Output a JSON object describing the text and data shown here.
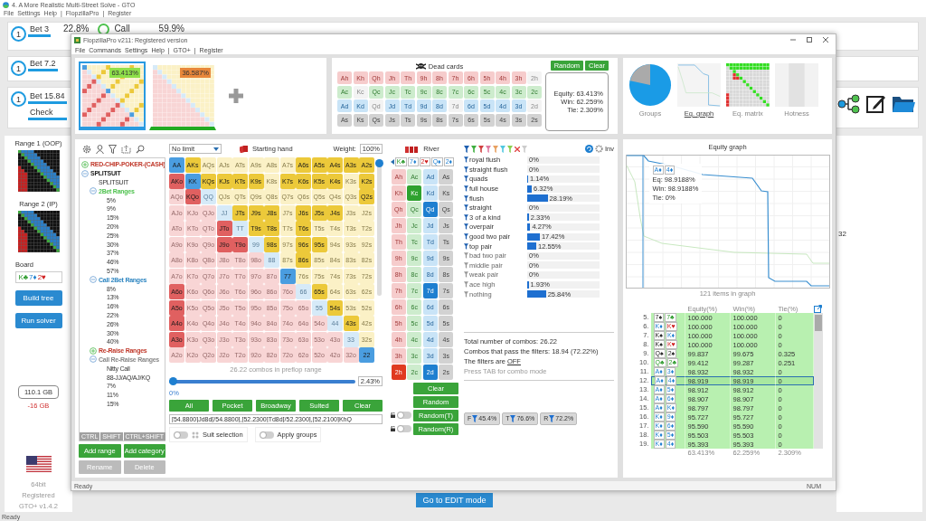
{
  "app": {
    "title": "4. A More Realistic Multi-Street Solve - GTO",
    "menu": [
      "File",
      "Settings",
      "Help",
      "|",
      "FlopzillaPro",
      "|",
      "Register"
    ]
  },
  "nodes": [
    {
      "player": "1",
      "actions": [
        "Bet 3"
      ],
      "freq": "22.8%",
      "next_action": "Call",
      "next_freq": "59.9%"
    },
    {
      "player": "1",
      "actions": [
        "Bet 7.2"
      ]
    },
    {
      "player": "1",
      "actions": [
        "Bet 15.84",
        "Check"
      ]
    }
  ],
  "sidebar": {
    "range1_label": "Range 1 (OOP)",
    "range2_label": "Range 2 (IP)",
    "board_label": "Board",
    "board": [
      {
        "text": "K♣",
        "kind": "clubs"
      },
      {
        "text": "7♦",
        "kind": "diamonds"
      },
      {
        "text": "2♥",
        "kind": "hearts"
      }
    ],
    "buttons": [
      "Build tree",
      "Run solver"
    ],
    "memory": "110.1 GB",
    "memory_delta": "-16 GB",
    "bits": "64bit",
    "registration": "Registered",
    "version": "GTO+ v1.4.2"
  },
  "edit_button": "Go to EDIT mode",
  "right_text": "32",
  "status": "Ready",
  "flopzilla": {
    "title": "FlopzillaPro v211: Registered version",
    "menu": [
      "File",
      "Commands",
      "Settings",
      "Help",
      "|",
      "GTO+",
      "|",
      "Register"
    ],
    "status": "Ready",
    "status_right": "NUM"
  },
  "range_slots": [
    {
      "equity": "63.413%",
      "selected": true,
      "color": "#8fe04a"
    },
    {
      "equity": "36.587%",
      "selected": false,
      "color": "#e8873a"
    }
  ],
  "dead_cards": {
    "title": "Dead cards",
    "buttons": [
      "Random",
      "Clear"
    ],
    "rows": [
      {
        "kind": "hearts",
        "cards": [
          "Ah",
          "Kh",
          "Qh",
          "Jh",
          "Th",
          "9h",
          "8h",
          "7h",
          "6h",
          "5h",
          "4h",
          "3h",
          "2h"
        ],
        "dead": [
          false,
          false,
          false,
          false,
          false,
          false,
          false,
          false,
          false,
          false,
          false,
          false,
          true
        ]
      },
      {
        "kind": "clubs",
        "cards": [
          "Ac",
          "Kc",
          "Qc",
          "Jc",
          "Tc",
          "9c",
          "8c",
          "7c",
          "6c",
          "5c",
          "4c",
          "3c",
          "2c"
        ],
        "dead": [
          false,
          true,
          false,
          false,
          false,
          false,
          false,
          false,
          false,
          false,
          false,
          false,
          false
        ]
      },
      {
        "kind": "diamonds",
        "cards": [
          "Ad",
          "Kd",
          "Qd",
          "Jd",
          "Td",
          "9d",
          "8d",
          "7d",
          "6d",
          "5d",
          "4d",
          "3d",
          "2d"
        ],
        "dead": [
          false,
          false,
          true,
          false,
          false,
          false,
          false,
          true,
          false,
          false,
          false,
          false,
          true
        ]
      },
      {
        "kind": "spades",
        "cards": [
          "As",
          "Ks",
          "Qs",
          "Js",
          "Ts",
          "9s",
          "8s",
          "7s",
          "6s",
          "5s",
          "4s",
          "3s",
          "2s"
        ],
        "dead": [
          false,
          false,
          false,
          false,
          false,
          false,
          false,
          false,
          false,
          false,
          false,
          false,
          false
        ]
      }
    ],
    "equity": "Equity: 63.413%",
    "win": "Win: 62.259%",
    "tie": "Tie: 2.309%"
  },
  "views": [
    {
      "label": "Groups",
      "selected": false,
      "kind": "pie"
    },
    {
      "label": "Eq. graph",
      "selected": true,
      "kind": "graph"
    },
    {
      "label": "Eq. matrix",
      "selected": false,
      "kind": "matrix"
    },
    {
      "label": "Hotness",
      "selected": false,
      "kind": "hotness"
    }
  ],
  "tree": [
    {
      "label": "RED-CHIP-POKER-(CASH)",
      "color": "#c0392b",
      "expanded": false
    },
    {
      "label": "SPLITSUIT",
      "color": "#222222",
      "expanded": true,
      "children": [
        {
          "label": "SPLITSUIT"
        },
        {
          "label": "2Bet Ranges",
          "color": "#4fc24f",
          "expanded": true,
          "children": [
            {
              "label": "5%"
            },
            {
              "label": "9%"
            },
            {
              "label": "15%"
            },
            {
              "label": "20%"
            },
            {
              "label": "25%"
            },
            {
              "label": "30%"
            },
            {
              "label": "37%"
            },
            {
              "label": "46%"
            },
            {
              "label": "57%"
            }
          ]
        },
        {
          "label": "Call 2Bet Ranges",
          "color": "#2e86c1",
          "expanded": true,
          "children": [
            {
              "label": "8%"
            },
            {
              "label": "13%"
            },
            {
              "label": "16%"
            },
            {
              "label": "22%"
            },
            {
              "label": "26%"
            },
            {
              "label": "30%"
            },
            {
              "label": "40%"
            }
          ]
        },
        {
          "label": "Re-Raise Ranges",
          "color": "#c0392b",
          "expanded": false
        },
        {
          "label": "Call Re-Raise Ranges",
          "color": "#888888",
          "expanded": true,
          "children": [
            {
              "label": "Nitty Call"
            },
            {
              "label": "88-JJ/AQ/AJ/KQ"
            },
            {
              "label": "7%"
            },
            {
              "label": "11%"
            },
            {
              "label": "15%"
            }
          ]
        }
      ]
    }
  ],
  "modifiers": [
    "CTRL",
    "SHIFT",
    "CTRL+SHIFT"
  ],
  "tree_buttons": [
    {
      "label": "Add range",
      "disabled": false
    },
    {
      "label": "Add category",
      "disabled": false
    },
    {
      "label": "Rename",
      "disabled": true
    },
    {
      "label": "Delete",
      "disabled": true
    }
  ],
  "hand_matrix": {
    "game": "No limit",
    "title": "Starting hand",
    "weight_label": "Weight:",
    "weight": "100%",
    "weight_slider": {
      "level": 1
    },
    "rows": [
      {
        "hands": [
          "AA",
          "AKs",
          "AQs",
          "AJs",
          "ATs",
          "A9s",
          "A8s",
          "A7s",
          "A6s",
          "A5s",
          "A4s",
          "A3s",
          "A2s"
        ],
        "in_range": [
          true,
          true,
          false,
          false,
          false,
          false,
          false,
          false,
          true,
          true,
          true,
          true,
          true
        ]
      },
      {
        "hands": [
          "AKo",
          "KK",
          "KQs",
          "KJs",
          "KTs",
          "K9s",
          "K8s",
          "K7s",
          "K6s",
          "K5s",
          "K4s",
          "K3s",
          "K2s"
        ],
        "in_range": [
          true,
          true,
          true,
          true,
          true,
          true,
          false,
          true,
          true,
          true,
          true,
          false,
          true
        ]
      },
      {
        "hands": [
          "AQo",
          "KQo",
          "QQ",
          "QJs",
          "QTs",
          "Q9s",
          "Q8s",
          "Q7s",
          "Q6s",
          "Q5s",
          "Q4s",
          "Q3s",
          "Q2s"
        ],
        "in_range": [
          false,
          true,
          false,
          false,
          false,
          false,
          false,
          false,
          false,
          false,
          false,
          false,
          true
        ]
      },
      {
        "hands": [
          "AJo",
          "KJo",
          "QJo",
          "JJ",
          "JTs",
          "J9s",
          "J8s",
          "J7s",
          "J6s",
          "J5s",
          "J4s",
          "J3s",
          "J2s"
        ],
        "in_range": [
          false,
          false,
          false,
          false,
          true,
          true,
          true,
          false,
          true,
          true,
          true,
          false,
          false
        ]
      },
      {
        "hands": [
          "ATo",
          "KTo",
          "QTo",
          "JTo",
          "TT",
          "T9s",
          "T8s",
          "T7s",
          "T6s",
          "T5s",
          "T4s",
          "T3s",
          "T2s"
        ],
        "in_range": [
          false,
          false,
          false,
          true,
          false,
          true,
          true,
          false,
          true,
          false,
          false,
          false,
          false
        ]
      },
      {
        "hands": [
          "A9o",
          "K9o",
          "Q9o",
          "J9o",
          "T9o",
          "99",
          "98s",
          "97s",
          "96s",
          "95s",
          "94s",
          "93s",
          "92s"
        ],
        "in_range": [
          false,
          false,
          false,
          true,
          true,
          false,
          true,
          false,
          true,
          true,
          false,
          false,
          false
        ]
      },
      {
        "hands": [
          "A8o",
          "K8o",
          "Q8o",
          "J8o",
          "T8o",
          "98o",
          "88",
          "87s",
          "86s",
          "85s",
          "84s",
          "83s",
          "82s"
        ],
        "in_range": [
          false,
          false,
          false,
          false,
          false,
          false,
          false,
          false,
          true,
          false,
          false,
          false,
          false
        ]
      },
      {
        "hands": [
          "A7o",
          "K7o",
          "Q7o",
          "J7o",
          "T7o",
          "97o",
          "87o",
          "77",
          "76s",
          "75s",
          "74s",
          "73s",
          "72s"
        ],
        "in_range": [
          false,
          false,
          false,
          false,
          false,
          false,
          false,
          true,
          false,
          false,
          false,
          false,
          false
        ]
      },
      {
        "hands": [
          "A6o",
          "K6o",
          "Q6o",
          "J6o",
          "T6o",
          "96o",
          "86o",
          "76o",
          "66",
          "65s",
          "64s",
          "63s",
          "62s"
        ],
        "in_range": [
          true,
          false,
          false,
          false,
          false,
          false,
          false,
          false,
          false,
          true,
          false,
          false,
          false
        ]
      },
      {
        "hands": [
          "A5o",
          "K5o",
          "Q5o",
          "J5o",
          "T5o",
          "95o",
          "85o",
          "75o",
          "65o",
          "55",
          "54s",
          "53s",
          "52s"
        ],
        "in_range": [
          true,
          false,
          false,
          false,
          false,
          false,
          false,
          false,
          false,
          false,
          true,
          false,
          false
        ]
      },
      {
        "hands": [
          "A4o",
          "K4o",
          "Q4o",
          "J4o",
          "T4o",
          "94o",
          "84o",
          "74o",
          "64o",
          "54o",
          "44",
          "43s",
          "42s"
        ],
        "in_range": [
          true,
          false,
          false,
          false,
          false,
          false,
          false,
          false,
          false,
          false,
          false,
          true,
          false
        ]
      },
      {
        "hands": [
          "A3o",
          "K3o",
          "Q3o",
          "J3o",
          "T3o",
          "93o",
          "83o",
          "73o",
          "63o",
          "53o",
          "43o",
          "33",
          "32s"
        ],
        "in_range": [
          true,
          false,
          false,
          false,
          false,
          false,
          false,
          false,
          false,
          false,
          false,
          false,
          false
        ]
      },
      {
        "hands": [
          "A2o",
          "K2o",
          "Q2o",
          "J2o",
          "T2o",
          "92o",
          "82o",
          "72o",
          "62o",
          "52o",
          "42o",
          "32o",
          "22"
        ],
        "in_range": [
          false,
          false,
          false,
          false,
          false,
          false,
          false,
          false,
          false,
          false,
          false,
          false,
          true
        ]
      }
    ],
    "combos": "26.22 combos in preflop range",
    "range_slider": {
      "level": 0
    },
    "slider_min": "0%",
    "slider_max": "2.43%",
    "presets": [
      "All",
      "Pocket",
      "Broadway",
      "Suited",
      "Clear"
    ],
    "range_text": "[54.8800]Jd8d[/54.8800],[52.2300]Td8d[/52.2300],[52.2100]KhQ",
    "toggles": [
      {
        "label": "Suit selection",
        "on": false
      },
      {
        "label": "Apply groups",
        "on": false
      }
    ]
  },
  "river": {
    "title": "River",
    "board": [
      {
        "text": "K♣",
        "kind": "clubs"
      },
      {
        "text": "7♦",
        "kind": "diamonds"
      },
      {
        "text": "2♥",
        "kind": "hearts"
      },
      {
        "text": "Q♦",
        "kind": "diamonds"
      },
      {
        "text": "2♦",
        "kind": "diamonds"
      }
    ],
    "columns": [
      {
        "kind": "hearts",
        "cards": [
          "Ah",
          "Kh",
          "Qh",
          "Jh",
          "Th",
          "9h",
          "8h",
          "7h",
          "6h",
          "5h",
          "4h",
          "3h",
          "2h"
        ],
        "selected": [
          false,
          false,
          false,
          false,
          false,
          false,
          false,
          false,
          false,
          false,
          false,
          false,
          true
        ]
      },
      {
        "kind": "clubs",
        "cards": [
          "Ac",
          "Kc",
          "Qc",
          "Jc",
          "Tc",
          "9c",
          "8c",
          "7c",
          "6c",
          "5c",
          "4c",
          "3c",
          "2c"
        ],
        "selected": [
          false,
          true,
          false,
          false,
          false,
          false,
          false,
          false,
          false,
          false,
          false,
          false,
          false
        ]
      },
      {
        "kind": "diamonds",
        "cards": [
          "Ad",
          "Kd",
          "Qd",
          "Jd",
          "Td",
          "9d",
          "8d",
          "7d",
          "6d",
          "5d",
          "4d",
          "3d",
          "2d"
        ],
        "selected": [
          false,
          false,
          true,
          false,
          false,
          false,
          false,
          true,
          false,
          false,
          false,
          false,
          true
        ]
      },
      {
        "kind": "spades",
        "cards": [
          "As",
          "Ks",
          "Qs",
          "Js",
          "Ts",
          "9s",
          "8s",
          "7s",
          "6s",
          "5s",
          "4s",
          "3s",
          "2s"
        ],
        "selected": [
          false,
          false,
          false,
          false,
          false,
          false,
          false,
          false,
          false,
          false,
          false,
          false,
          false
        ]
      }
    ],
    "buttons": [
      {
        "label": "Clear"
      },
      {
        "label": "Random"
      },
      {
        "label": "Random(T)",
        "locked": false
      },
      {
        "label": "Random(R)",
        "locked": false
      }
    ]
  },
  "filters": {
    "inv": "Inv",
    "items": [
      {
        "label": "royal flush",
        "value": "0%",
        "level": 0,
        "active": true
      },
      {
        "label": "straight flush",
        "value": "0%",
        "level": 0,
        "active": true
      },
      {
        "label": "quads",
        "value": "1.14%",
        "level": 0.0114,
        "active": true
      },
      {
        "label": "full house",
        "value": "6.32%",
        "level": 0.0632,
        "active": true
      },
      {
        "label": "flush",
        "value": "28.19%",
        "level": 0.2819,
        "active": true
      },
      {
        "label": "straight",
        "value": "0%",
        "level": 0,
        "active": true
      },
      {
        "label": "3 of a kind",
        "value": "2.33%",
        "level": 0.0233,
        "active": true
      },
      {
        "label": "overpair",
        "value": "4.27%",
        "level": 0.0427,
        "active": true
      },
      {
        "label": "good two pair",
        "value": "17.42%",
        "level": 0.1742,
        "active": true
      },
      {
        "label": "top pair",
        "value": "12.55%",
        "level": 0.1255,
        "active": true
      },
      {
        "label": "bad two pair",
        "value": "0%",
        "level": 0,
        "active": false
      },
      {
        "label": "middle pair",
        "value": "0%",
        "level": 0,
        "active": false
      },
      {
        "label": "weak pair",
        "value": "0%",
        "level": 0,
        "active": false
      },
      {
        "label": "ace high",
        "value": "1.93%",
        "level": 0.0193,
        "active": false
      },
      {
        "label": "nothing",
        "value": "25.84%",
        "level": 0.2584,
        "active": false
      }
    ],
    "total": "Total number of combos: 26.22",
    "passing": "Combos that pass the filters: 18.94 (72.22%)",
    "state_prefix": "The filters are",
    "state": "OFF",
    "hint": "Press TAB for combo mode",
    "badges": [
      {
        "letter": "F",
        "value": "45.4%"
      },
      {
        "letter": "T",
        "value": "76.6%"
      },
      {
        "letter": "R",
        "value": "72.2%"
      }
    ]
  },
  "equity_graph": {
    "title": "Equity graph",
    "tooltip": {
      "cards": [
        {
          "text": "A♦",
          "kind": "diamonds"
        },
        {
          "text": "4♦",
          "kind": "diamonds"
        }
      ],
      "lines": [
        "Eq: 98.9188%",
        "Win: 98.9188%",
        "Tie: 0%"
      ]
    },
    "caption": "121 items in graph"
  },
  "table": {
    "columns": [
      "Equity(%)",
      "Win(%)",
      "Tie(%)"
    ],
    "rows": [
      {
        "index": "5.",
        "cards": [
          {
            "text": "7♠",
            "kind": "spades"
          },
          {
            "text": "7♣",
            "kind": "clubs"
          }
        ],
        "equity": "100.000",
        "win": "100.000",
        "tie": "0",
        "selected": false
      },
      {
        "index": "6.",
        "cards": [
          {
            "text": "K♦",
            "kind": "diamonds"
          },
          {
            "text": "K♥",
            "kind": "hearts"
          }
        ],
        "equity": "100.000",
        "win": "100.000",
        "tie": "0",
        "selected": false
      },
      {
        "index": "7.",
        "cards": [
          {
            "text": "K♠",
            "kind": "spades"
          },
          {
            "text": "K♦",
            "kind": "diamonds"
          }
        ],
        "equity": "100.000",
        "win": "100.000",
        "tie": "0",
        "selected": false
      },
      {
        "index": "8.",
        "cards": [
          {
            "text": "K♠",
            "kind": "spades"
          },
          {
            "text": "K♥",
            "kind": "hearts"
          }
        ],
        "equity": "100.000",
        "win": "100.000",
        "tie": "0",
        "selected": false
      },
      {
        "index": "9.",
        "cards": [
          {
            "text": "Q♠",
            "kind": "spades"
          },
          {
            "text": "2♠",
            "kind": "spades"
          }
        ],
        "equity": "99.837",
        "win": "99.675",
        "tie": "0.325",
        "selected": false
      },
      {
        "index": "10.",
        "cards": [
          {
            "text": "Q♣",
            "kind": "clubs"
          },
          {
            "text": "2♣",
            "kind": "clubs"
          }
        ],
        "equity": "99.412",
        "win": "99.287",
        "tie": "0.251",
        "selected": false
      },
      {
        "index": "11.",
        "cards": [
          {
            "text": "A♦",
            "kind": "diamonds"
          },
          {
            "text": "3♦",
            "kind": "diamonds"
          }
        ],
        "equity": "98.932",
        "win": "98.932",
        "tie": "0",
        "selected": false
      },
      {
        "index": "12.",
        "cards": [
          {
            "text": "A♦",
            "kind": "diamonds"
          },
          {
            "text": "4♦",
            "kind": "diamonds"
          }
        ],
        "equity": "98.919",
        "win": "98.919",
        "tie": "0",
        "selected": true
      },
      {
        "index": "13.",
        "cards": [
          {
            "text": "A♦",
            "kind": "diamonds"
          },
          {
            "text": "5♦",
            "kind": "diamonds"
          }
        ],
        "equity": "98.912",
        "win": "98.912",
        "tie": "0",
        "selected": false
      },
      {
        "index": "14.",
        "cards": [
          {
            "text": "A♦",
            "kind": "diamonds"
          },
          {
            "text": "6♦",
            "kind": "diamonds"
          }
        ],
        "equity": "98.907",
        "win": "98.907",
        "tie": "0",
        "selected": false
      },
      {
        "index": "15.",
        "cards": [
          {
            "text": "A♦",
            "kind": "diamonds"
          },
          {
            "text": "K♦",
            "kind": "diamonds"
          }
        ],
        "equity": "98.797",
        "win": "98.797",
        "tie": "0",
        "selected": false
      },
      {
        "index": "16.",
        "cards": [
          {
            "text": "K♦",
            "kind": "diamonds"
          },
          {
            "text": "9♦",
            "kind": "diamonds"
          }
        ],
        "equity": "95.727",
        "win": "95.727",
        "tie": "0",
        "selected": false
      },
      {
        "index": "17.",
        "cards": [
          {
            "text": "K♦",
            "kind": "diamonds"
          },
          {
            "text": "6♦",
            "kind": "diamonds"
          }
        ],
        "equity": "95.590",
        "win": "95.590",
        "tie": "0",
        "selected": false
      },
      {
        "index": "18.",
        "cards": [
          {
            "text": "K♦",
            "kind": "diamonds"
          },
          {
            "text": "5♦",
            "kind": "diamonds"
          }
        ],
        "equity": "95.503",
        "win": "95.503",
        "tie": "0",
        "selected": false
      },
      {
        "index": "19.",
        "cards": [
          {
            "text": "K♦",
            "kind": "diamonds"
          },
          {
            "text": "4♦",
            "kind": "diamonds"
          }
        ],
        "equity": "95.393",
        "win": "95.393",
        "tie": "0",
        "selected": false
      }
    ],
    "totals": [
      "63.413%",
      "62.259%",
      "2.309%"
    ]
  }
}
